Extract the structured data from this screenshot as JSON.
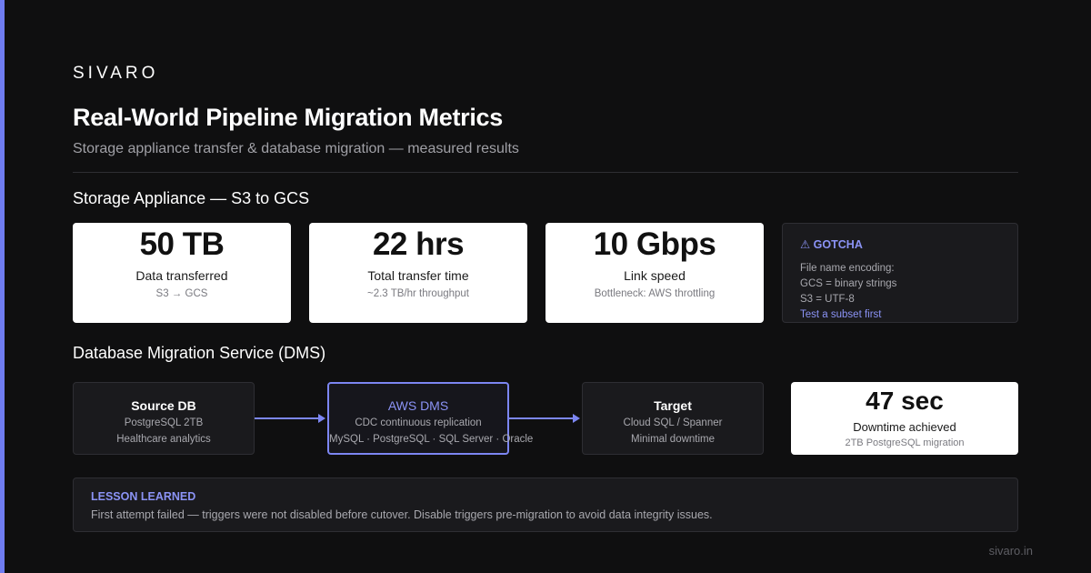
{
  "brand": "SIVARO",
  "title": "Real-World Pipeline Migration Metrics",
  "subtitle": "Storage appliance transfer & database migration — measured results",
  "storage_section": {
    "title": "Storage Appliance — S3 to GCS",
    "metrics": [
      {
        "value": "50 TB",
        "label": "Data transferred",
        "sub": "S3 → GCS"
      },
      {
        "value": "22 hrs",
        "label": "Total transfer time",
        "sub": "~2.3 TB/hr throughput"
      },
      {
        "value": "10 Gbps",
        "label": "Link speed",
        "sub": "Bottleneck: AWS throttling"
      }
    ],
    "gotcha": {
      "title": "⚠ GOTCHA",
      "lines": [
        "File name encoding:",
        "GCS = binary strings",
        "S3 = UTF-8"
      ],
      "link": "Test a subset first"
    }
  },
  "dms_section": {
    "title": "Database Migration Service (DMS)",
    "flow": [
      {
        "title": "Source DB",
        "lines": [
          "PostgreSQL 2TB",
          "Healthcare analytics"
        ]
      },
      {
        "title": "AWS DMS",
        "lines": [
          "CDC continuous replication",
          "MySQL · PostgreSQL · SQL Server · Oracle"
        ]
      },
      {
        "title": "Target",
        "lines": [
          "Cloud SQL / Spanner",
          "Minimal downtime"
        ]
      }
    ],
    "downtime": {
      "value": "47 sec",
      "label": "Downtime achieved",
      "sub": "2TB PostgreSQL migration"
    }
  },
  "lesson": {
    "title": "LESSON LEARNED",
    "text": "First attempt failed — triggers were not disabled before cutover. Disable triggers pre-migration to avoid data integrity issues."
  },
  "footer": "sivaro.in",
  "colors": {
    "background": "#0f0f10",
    "accent": "#7c86f2",
    "card": "#ffffff",
    "panel": "#1a1a1d"
  }
}
